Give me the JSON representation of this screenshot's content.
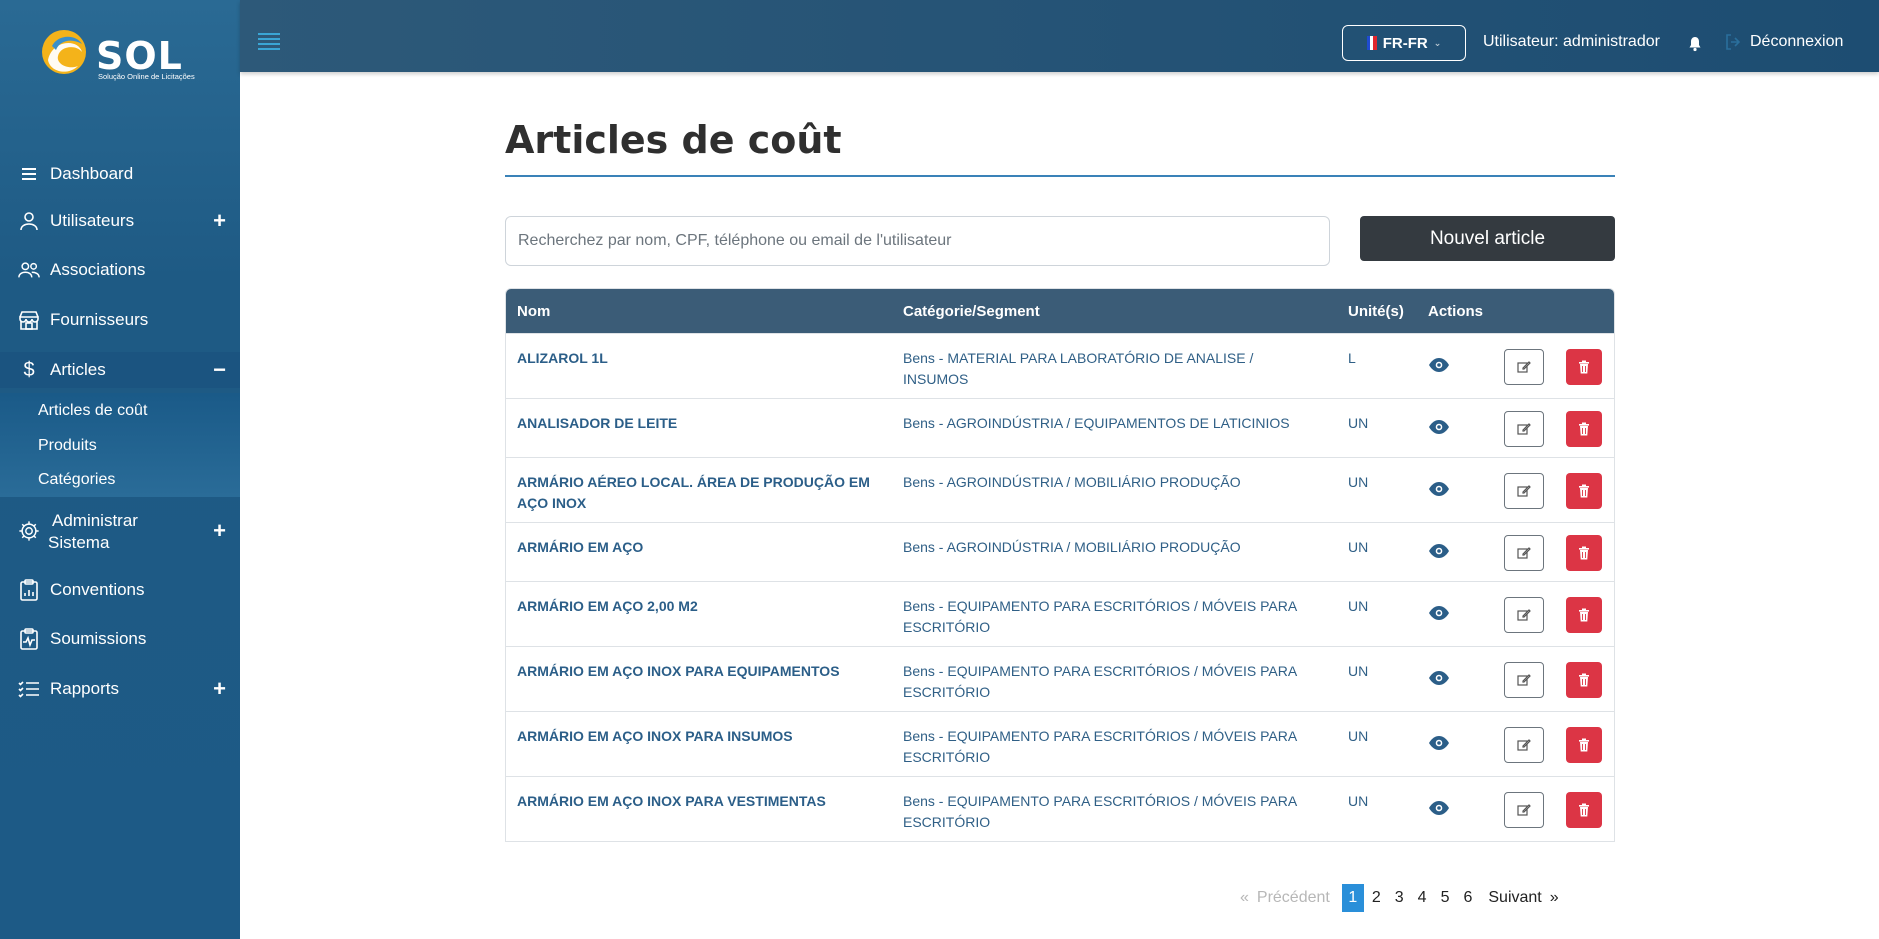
{
  "brand": {
    "name": "SOL",
    "tagline": "Solução Online de Licitações"
  },
  "sidebar": {
    "items": [
      {
        "label": "Dashboard",
        "icon": "menu-lines-icon"
      },
      {
        "label": "Utilisateurs",
        "icon": "user-icon",
        "toggle": "+"
      },
      {
        "label": "Associations",
        "icon": "users-icon"
      },
      {
        "label": "Fournisseurs",
        "icon": "store-icon"
      },
      {
        "label": "Articles",
        "icon": "dollar-icon",
        "toggle": "−"
      },
      {
        "label": "Administrar Sistema",
        "icon": "gear-icon",
        "toggle": "+"
      },
      {
        "label": "Conventions",
        "icon": "clipboard-chart-icon"
      },
      {
        "label": "Soumissions",
        "icon": "clipboard-pulse-icon"
      },
      {
        "label": "Rapports",
        "icon": "list-check-icon",
        "toggle": "+"
      }
    ],
    "sub_items": [
      "Articles de coût",
      "Produits",
      "Catégories"
    ],
    "admin_line1": "Administrar",
    "admin_line2": "Sistema"
  },
  "header": {
    "language": "FR-FR",
    "user_label": "Utilisateur: administrador",
    "logout": "Déconnexion"
  },
  "main": {
    "title": "Articles de coût",
    "search_placeholder": "Recherchez par nom, CPF, téléphone ou email de l'utilisateur",
    "new_button": "Nouvel article"
  },
  "table": {
    "columns": [
      "Nom",
      "Catégorie/Segment",
      "Unité(s)",
      "Actions"
    ],
    "rows": [
      {
        "nom": "ALIZAROL 1L",
        "categorie": "Bens - MATERIAL PARA LABORATÓRIO DE ANALISE / INSUMOS",
        "unite": "L"
      },
      {
        "nom": "ANALISADOR DE LEITE",
        "categorie": "Bens - AGROINDÚSTRIA / EQUIPAMENTOS DE LATICINIOS",
        "unite": "UN"
      },
      {
        "nom": "ARMÁRIO AÉREO LOCAL. ÁREA DE PRODUÇÃO EM AÇO INOX",
        "categorie": "Bens - AGROINDÚSTRIA / MOBILIÁRIO PRODUÇÃO",
        "unite": "UN"
      },
      {
        "nom": "ARMÁRIO EM AÇO",
        "categorie": "Bens - AGROINDÚSTRIA / MOBILIÁRIO PRODUÇÃO",
        "unite": "UN"
      },
      {
        "nom": "ARMÁRIO EM AÇO 2,00 M2",
        "categorie": "Bens - EQUIPAMENTO PARA ESCRITÓRIOS / MÓVEIS PARA ESCRITÓRIO",
        "unite": "UN"
      },
      {
        "nom": "ARMÁRIO EM AÇO INOX PARA EQUIPAMENTOS",
        "categorie": "Bens - EQUIPAMENTO PARA ESCRITÓRIOS / MÓVEIS PARA ESCRITÓRIO",
        "unite": "UN"
      },
      {
        "nom": "ARMÁRIO EM AÇO INOX PARA INSUMOS",
        "categorie": "Bens - EQUIPAMENTO PARA ESCRITÓRIOS / MÓVEIS PARA ESCRITÓRIO",
        "unite": "UN"
      },
      {
        "nom": "ARMÁRIO EM AÇO INOX PARA VESTIMENTAS",
        "categorie": "Bens - EQUIPAMENTO PARA ESCRITÓRIOS / MÓVEIS PARA ESCRITÓRIO",
        "unite": "UN"
      }
    ]
  },
  "pagination": {
    "prev_symbol": "«",
    "prev": "Précédent",
    "pages": [
      "1",
      "2",
      "3",
      "4",
      "5",
      "6"
    ],
    "current": "1",
    "next": "Suivant",
    "next_symbol": "»"
  },
  "colors": {
    "sidebar": "#1d5a86",
    "topbar": "#1d4d72",
    "accent": "#2a8fd9",
    "table_header": "#3b5c77",
    "danger": "#dc3545",
    "dark_button": "#343a40"
  }
}
